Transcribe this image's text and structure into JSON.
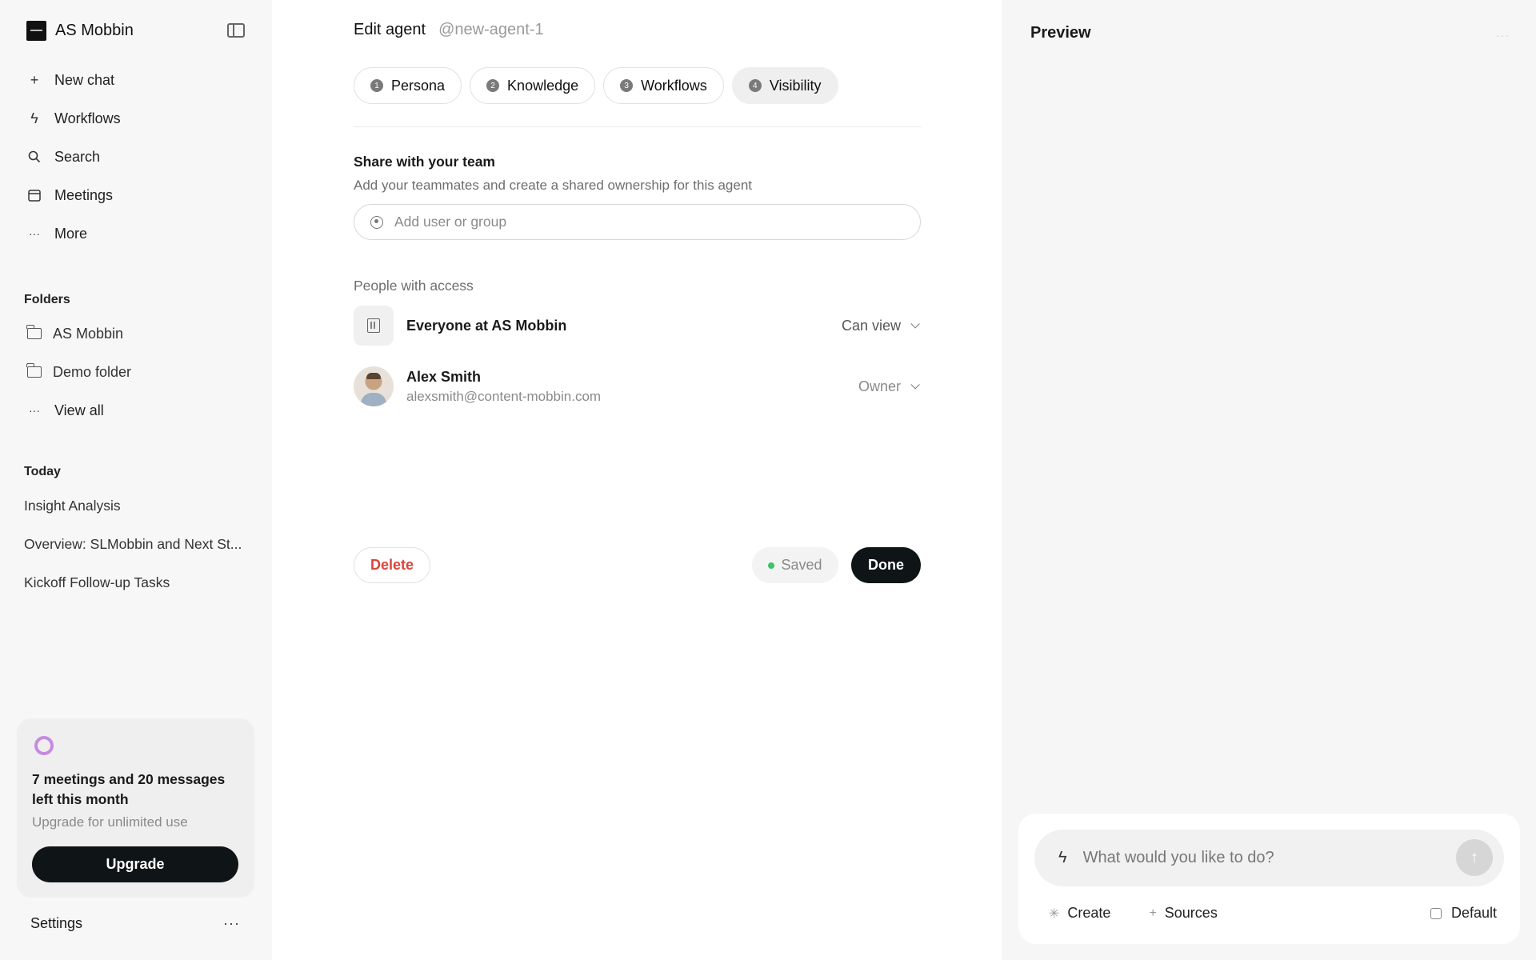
{
  "sidebar": {
    "brand": "AS Mobbin",
    "nav": [
      {
        "icon": "plus-icon",
        "label": "New chat"
      },
      {
        "icon": "bolt-icon",
        "label": "Workflows"
      },
      {
        "icon": "search-icon",
        "label": "Search"
      },
      {
        "icon": "calendar-icon",
        "label": "Meetings"
      },
      {
        "icon": "more-icon",
        "label": "More"
      }
    ],
    "folders_title": "Folders",
    "folders": [
      "AS Mobbin",
      "Demo folder"
    ],
    "view_all": "View all",
    "today_title": "Today",
    "today": [
      "Insight Analysis",
      "Overview: SLMobbin and Next St...",
      "Kickoff Follow-up Tasks"
    ],
    "usage": {
      "title": "7 meetings and 20 messages left this month",
      "subtitle": "Upgrade for unlimited use",
      "button": "Upgrade",
      "accent": "#c58be0"
    },
    "settings": "Settings",
    "settings_more": "···"
  },
  "editor": {
    "title": "Edit agent",
    "handle": "@new-agent-1",
    "steps": [
      {
        "num": "1",
        "label": "Persona"
      },
      {
        "num": "2",
        "label": "Knowledge"
      },
      {
        "num": "3",
        "label": "Workflows"
      },
      {
        "num": "4",
        "label": "Visibility",
        "active": true
      }
    ],
    "share_title": "Share with your team",
    "share_subtitle": "Add your teammates and create a shared ownership for this agent",
    "share_placeholder": "Add user or group",
    "access_title": "People with access",
    "access": [
      {
        "name": "Everyone at AS Mobbin",
        "email": "",
        "role": "Can view"
      },
      {
        "name": "Alex Smith",
        "email": "alexsmith@content-mobbin.com",
        "role": "Owner"
      }
    ],
    "delete": "Delete",
    "saved": "Saved",
    "done": "Done",
    "colors": {
      "danger": "#d9453a",
      "saved_dot": "#3cc36b",
      "primary": "#0f1416"
    }
  },
  "preview": {
    "title": "Preview",
    "menu": "···",
    "composer_placeholder": "What would you like to do?",
    "actions": {
      "create": "Create",
      "sources": "Sources",
      "model": "Default"
    },
    "send_icon": "arrow-up-icon"
  }
}
